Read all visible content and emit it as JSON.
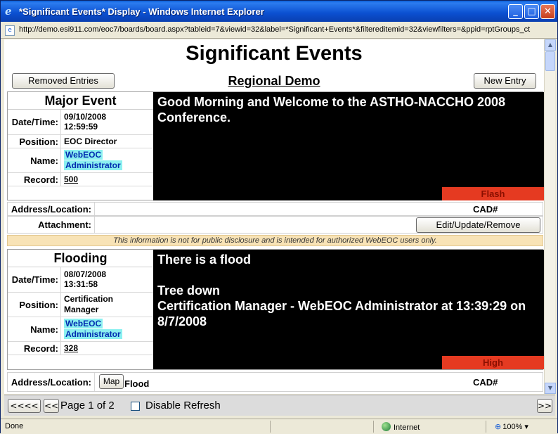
{
  "window": {
    "title": "*Significant Events* Display - Windows Internet Explorer",
    "minimize": "_",
    "maximize": "□",
    "close": "✕"
  },
  "address": {
    "url": "http://demo.esi911.com/eoc7/boards/board.aspx?tableid=7&viewid=32&label=*Significant+Events*&filtereditemid=32&viewfilters=&ppid=rptGroups_ct"
  },
  "board": {
    "title": "Significant Events",
    "subtitle": "Regional Demo",
    "removed_button": "Removed Entries",
    "new_button": "New Entry"
  },
  "events": [
    {
      "name": "Major Event",
      "labels": {
        "datetime": "Date/Time:",
        "position": "Position:",
        "name": "Name:",
        "record": "Record:"
      },
      "date": "09/10/2008",
      "time": "12:59:59",
      "position": "EOC Director",
      "user_line1": "WebEOC",
      "user_line2": "Administrator",
      "record": "500",
      "message": "Good Morning and Welcome to the ASTHO-NACCHO 2008 Conference.",
      "flag": "Flash"
    },
    {
      "name": "Flooding",
      "labels": {
        "datetime": "Date/Time:",
        "position": "Position:",
        "name": "Name:",
        "record": "Record:"
      },
      "date": "08/07/2008",
      "time": "13:31:58",
      "position_line1": "Certification",
      "position_line2": "Manager",
      "user_line1": "WebEOC",
      "user_line2": "Administrator",
      "record": "328",
      "message_line1": "There is a flood",
      "message_line2": "Tree down",
      "message_line3": "Certification Manager - WebEOC Administrator at 13:39:29 on 8/7/2008",
      "flag": "High",
      "map_button": "Map",
      "location": "Flood"
    }
  ],
  "details": {
    "address_label": "Address/Location:",
    "attachment_label": "Attachment:",
    "cad_label": "CAD#",
    "edit_button": "Edit/Update/Remove",
    "disclaimer": "This information is not for public disclosure and is intended for authorized WebEOC users only."
  },
  "nav": {
    "first": "<<<<",
    "prev": "<<",
    "page_info": "Page 1 of 2",
    "disable_refresh": "Disable Refresh",
    "next": ">>"
  },
  "status": {
    "text": "Done",
    "zone": "Internet",
    "zoom": "100%"
  },
  "colors": {
    "flag_red": "#e53a21",
    "name_highlight": "#8bf0f0",
    "disclaimer_bg": "#f8e3b6",
    "message_bg": "#000000"
  }
}
